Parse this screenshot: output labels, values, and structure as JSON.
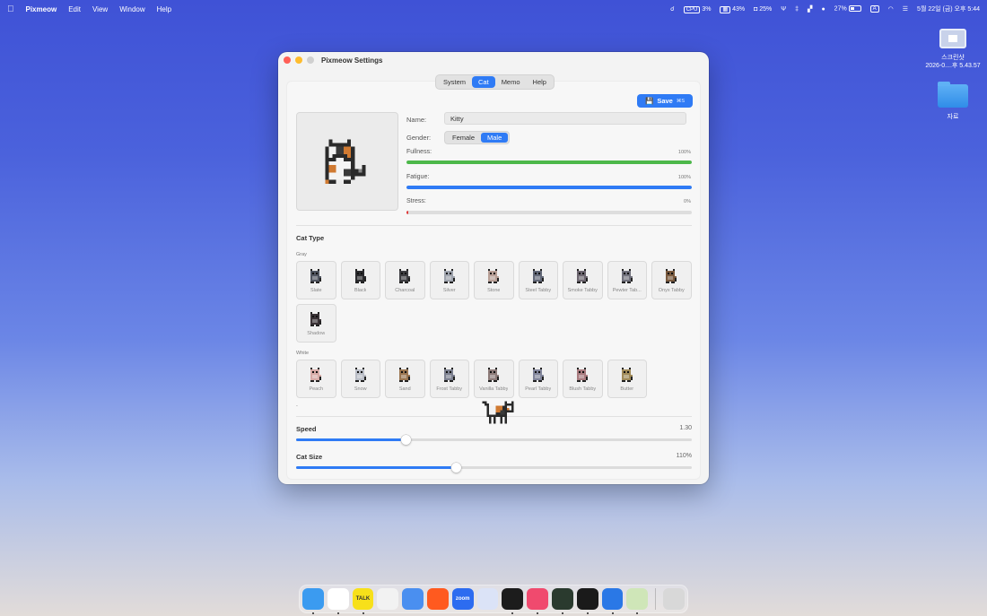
{
  "menubar": {
    "app_name": "Pixmeow",
    "menus": [
      "Edit",
      "View",
      "Window",
      "Help"
    ],
    "status": {
      "cpu": "3%",
      "mem": "43%",
      "disk": "25%",
      "battery": "27%",
      "input": "A",
      "datetime": "5월 22일 (금) 오후 5:44"
    }
  },
  "desktop": {
    "screenshot_label_1": "스크린샷",
    "screenshot_label_2": "2026-0....후 5.43.57",
    "folder_label": "자료"
  },
  "window": {
    "title": "Pixmeow Settings",
    "tabs": [
      {
        "label": "System",
        "active": false
      },
      {
        "label": "Cat",
        "active": true
      },
      {
        "label": "Memo",
        "active": false
      },
      {
        "label": "Help",
        "active": false
      }
    ],
    "save": {
      "label": "Save",
      "shortcut": "⌘S"
    },
    "name": {
      "label": "Name:",
      "value": "Kitty"
    },
    "gender": {
      "label": "Gender:",
      "options": [
        "Female",
        "Male"
      ],
      "selected": "Male"
    },
    "stats": [
      {
        "label": "Fullness:",
        "value": "100%",
        "fraction": 1.0,
        "color": "#4cb84a"
      },
      {
        "label": "Fatigue:",
        "value": "100%",
        "fraction": 1.0,
        "color": "#2f7bf5"
      },
      {
        "label": "Stress:",
        "value": "0%",
        "fraction": 0.0,
        "color": "#e03a3a"
      }
    ],
    "cat_type": {
      "title": "Cat Type",
      "groups": [
        {
          "label": "Gray",
          "cats": [
            {
              "name": "Slate",
              "color": "#505560"
            },
            {
              "name": "Black",
              "color": "#2b2b2e"
            },
            {
              "name": "Charcoal",
              "color": "#3e3e42"
            },
            {
              "name": "Silver",
              "color": "#9ea3ad"
            },
            {
              "name": "Stone",
              "color": "#b89f96"
            },
            {
              "name": "Steel Tabby",
              "color": "#626878"
            },
            {
              "name": "Smoke Tabby",
              "color": "#6d6670"
            },
            {
              "name": "Pewter Tab...",
              "color": "#71717c"
            },
            {
              "name": "Onyx Tabby",
              "color": "#7a5a3e"
            },
            {
              "name": "Shadow",
              "color": "#3a3236"
            }
          ]
        },
        {
          "label": "White",
          "cats": [
            {
              "name": "Peach",
              "color": "#d6aaa6"
            },
            {
              "name": "Snow",
              "color": "#b9bdc6"
            },
            {
              "name": "Sand",
              "color": "#9a7550"
            },
            {
              "name": "Frost Tabby",
              "color": "#7c8090"
            },
            {
              "name": "Vanilla Tabby",
              "color": "#8c7a78"
            },
            {
              "name": "Pearl Tabby",
              "color": "#80849a"
            },
            {
              "name": "Blush Tabby",
              "color": "#a87a7e"
            },
            {
              "name": "Butter",
              "color": "#a08a58"
            }
          ]
        }
      ],
      "more_marker": "-"
    },
    "speed": {
      "label": "Speed",
      "value": "1.30",
      "fraction": 0.277
    },
    "cat_size": {
      "label": "Cat Size",
      "value": "110%",
      "fraction": 0.404
    }
  },
  "dock": {
    "apps": [
      {
        "icon": "finder-icon",
        "color": "#3b9bf0",
        "running": true
      },
      {
        "icon": "chrome-icon",
        "color": "#ffffff",
        "running": true
      },
      {
        "icon": "kakaotalk-icon",
        "color": "#f7e01a",
        "running": true,
        "text": "TALK"
      },
      {
        "icon": "instagram-icon",
        "color": "#f2f2f2",
        "running": false
      },
      {
        "icon": "mail-icon",
        "color": "#4a8ff0",
        "running": false
      },
      {
        "icon": "reddit-icon",
        "color": "#ff5a1f",
        "running": false
      },
      {
        "icon": "zoom-icon",
        "color": "#2d6cf0",
        "running": false,
        "text": "zoom"
      },
      {
        "icon": "copilot-icon",
        "color": "#dbe3f7",
        "running": false
      },
      {
        "icon": "terminal-icon",
        "color": "#1c1c1c",
        "running": true
      },
      {
        "icon": "music-player-icon",
        "color": "#f04a6e",
        "running": true
      },
      {
        "icon": "activity-monitor-icon",
        "color": "#2a3a2e",
        "running": true
      },
      {
        "icon": "github-icon",
        "color": "#1a1a1a",
        "running": true
      },
      {
        "icon": "xcode-icon",
        "color": "#2a78e6",
        "running": true
      },
      {
        "icon": "pixmeow-icon",
        "color": "#cfe6b8",
        "running": true
      }
    ],
    "trash": {
      "icon": "trash-icon",
      "color": "#d8d8d8"
    }
  }
}
